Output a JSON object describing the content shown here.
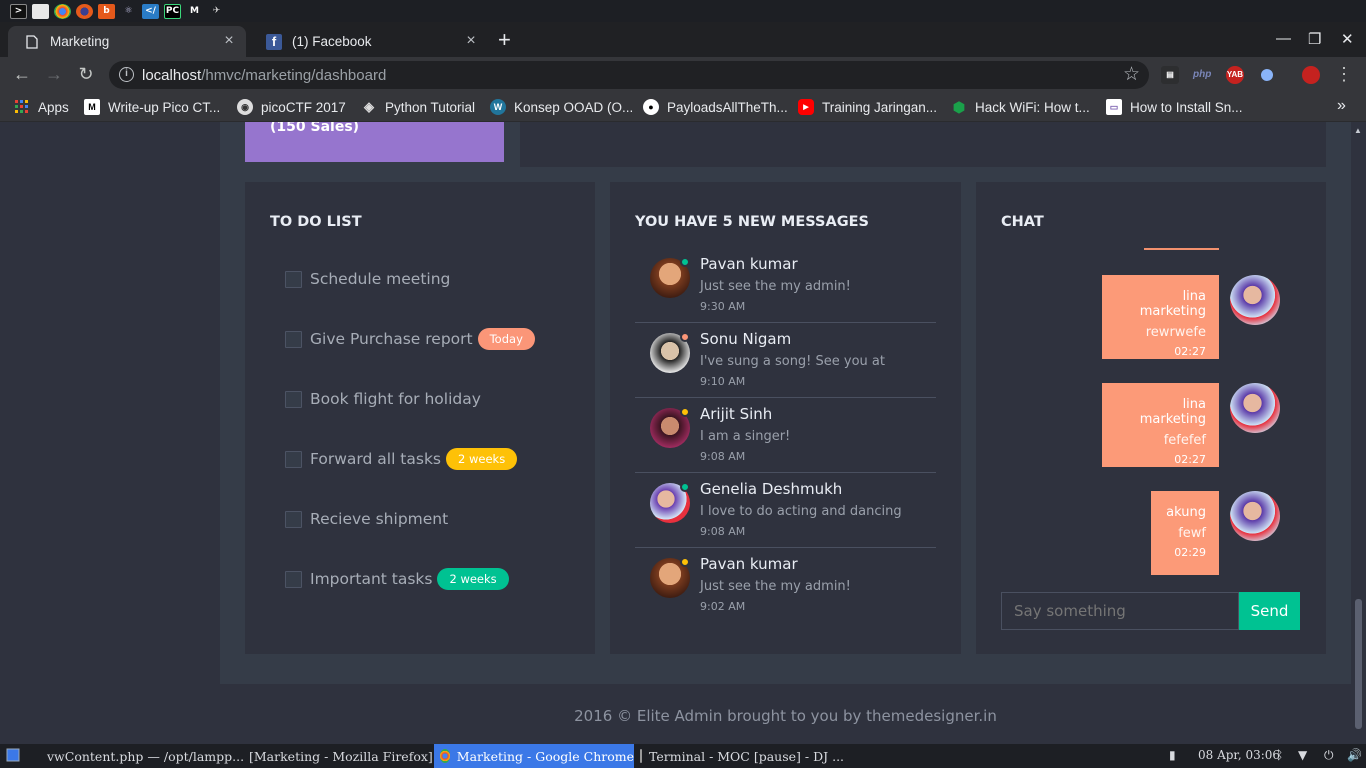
{
  "tabs": [
    {
      "title": "Marketing",
      "close": "×"
    },
    {
      "title": "(1) Facebook",
      "close": "×"
    }
  ],
  "new_tab": "+",
  "window_controls": {
    "minimize": "—",
    "maximize": "❐",
    "close": "✕"
  },
  "omnibox": {
    "host": "localhost",
    "path": "/hmvc/marketing/dashboard",
    "info": "i"
  },
  "extensions": [
    "php",
    "YAB"
  ],
  "bookmarks": [
    {
      "label": "Apps",
      "icon": "apps-grid-icon"
    },
    {
      "label": "Write-up Pico CT...",
      "icon": "medium-icon"
    },
    {
      "label": "picoCTF 2017",
      "icon": "picoctf-icon"
    },
    {
      "label": "Python Tutorial",
      "icon": "python-icon"
    },
    {
      "label": "Konsep OOAD (O...",
      "icon": "wordpress-icon"
    },
    {
      "label": "PayloadsAllTheTh...",
      "icon": "github-icon"
    },
    {
      "label": "Training Jaringan...",
      "icon": "youtube-icon"
    },
    {
      "label": "Hack WiFi: How t...",
      "icon": "hexagon-icon"
    },
    {
      "label": "How to Install Sn...",
      "icon": "site-icon"
    }
  ],
  "bookmarks_more": "»",
  "top_card": {
    "sales_text": "(150 Sales)"
  },
  "todo": {
    "title": "TO DO LIST",
    "items": [
      {
        "label": "Schedule meeting",
        "badge": null
      },
      {
        "label": "Give Purchase report",
        "badge": "Today"
      },
      {
        "label": "Book flight for holiday",
        "badge": null
      },
      {
        "label": "Forward all tasks",
        "badge": "2 weeks"
      },
      {
        "label": "Recieve shipment",
        "badge": null
      },
      {
        "label": "Important tasks",
        "badge": "2 weeks"
      }
    ]
  },
  "messages": {
    "title": "YOU HAVE 5 NEW MESSAGES",
    "items": [
      {
        "name": "Pavan kumar",
        "text": "Just see the my admin!",
        "time": "9:30 AM",
        "status_color": "#00c292"
      },
      {
        "name": "Sonu Nigam",
        "text": "I've sung a song! See you at",
        "time": "9:10 AM",
        "status_color": "#fb9678"
      },
      {
        "name": "Arijit Sinh",
        "text": "I am a singer!",
        "time": "9:08 AM",
        "status_color": "#fec107"
      },
      {
        "name": "Genelia Deshmukh",
        "text": "I love to do acting and dancing",
        "time": "9:08 AM",
        "status_color": "#00c292"
      },
      {
        "name": "Pavan kumar",
        "text": "Just see the my admin!",
        "time": "9:02 AM",
        "status_color": "#fec107"
      }
    ]
  },
  "chat": {
    "title": "CHAT",
    "messages": [
      {
        "name": "lina marketing",
        "text": "rewrwefe",
        "time": "02:27"
      },
      {
        "name": "lina marketing",
        "text": "fefefef",
        "time": "02:27"
      },
      {
        "name": "akung",
        "text": "fewf",
        "time": "02:29"
      }
    ],
    "input_placeholder": "Say something",
    "send_label": "Send"
  },
  "footer": "2016 © Elite Admin brought to you by themedesigner.in",
  "taskbar": {
    "tasks": [
      {
        "label": "vwContent.php — /opt/lampp...",
        "active": false
      },
      {
        "label": "[Marketing - Mozilla Firefox]",
        "active": false
      },
      {
        "label": "Marketing - Google Chrome",
        "active": true
      },
      {
        "label": "Terminal - MOC [pause] - DJ ...",
        "active": false
      }
    ],
    "clock": "08 Apr, 03:06"
  },
  "colors": {
    "accent_orange": "#fb9678",
    "accent_green": "#00c292",
    "accent_yellow": "#fec107",
    "accent_purple": "#9675ce",
    "bg_panel": "#2f323e",
    "bg_content": "#353c48"
  }
}
